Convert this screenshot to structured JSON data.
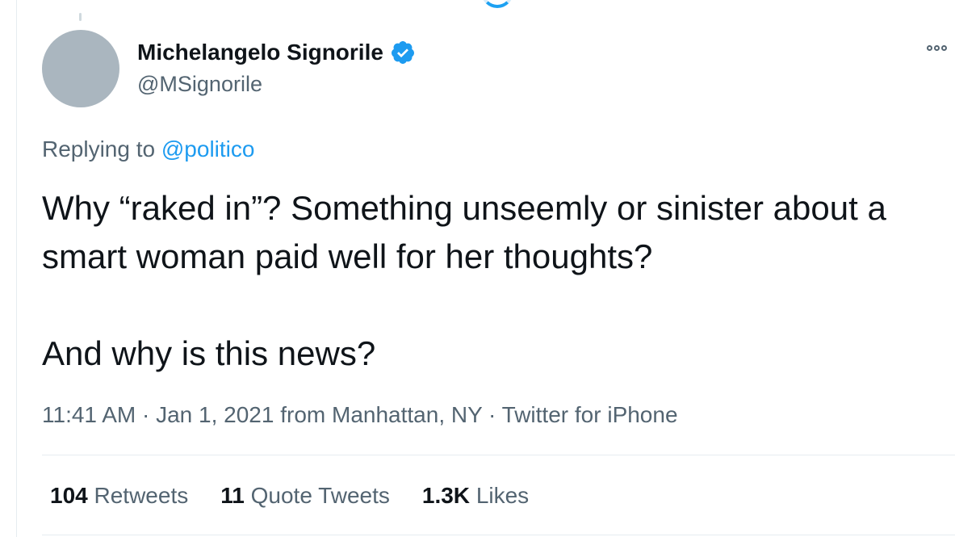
{
  "tweet": {
    "author": {
      "display_name": "Michelangelo Signorile",
      "handle": "@MSignorile",
      "verified_icon": "verified-badge-icon"
    },
    "reply": {
      "prefix": "Replying to ",
      "mention": "@politico"
    },
    "body": {
      "paragraph_1": "Why “raked in”? Something unseemly or sinister about a smart woman paid well for her thoughts?",
      "paragraph_2": "And why is this news?"
    },
    "meta": "11:41 AM · Jan 1, 2021 from Manhattan, NY · Twitter for iPhone",
    "stats": [
      {
        "count": "104",
        "label": "Retweets"
      },
      {
        "count": "11",
        "label": "Quote Tweets"
      },
      {
        "count": "1.3K",
        "label": "Likes"
      }
    ]
  },
  "colors": {
    "accent": "#1d9bf0",
    "secondary_text": "#536471",
    "primary_text": "#0f1419",
    "avatar_placeholder": "#aab6bf"
  }
}
